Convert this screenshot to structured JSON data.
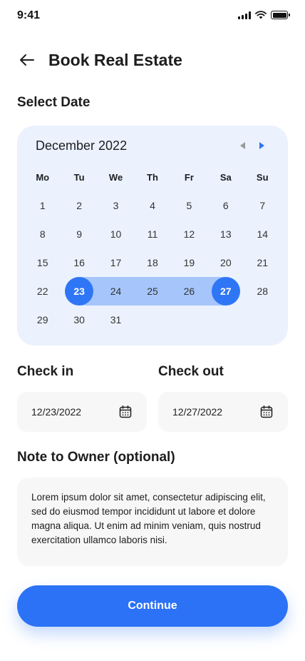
{
  "status_bar": {
    "time": "9:41"
  },
  "header": {
    "title": "Book Real Estate"
  },
  "select_date": {
    "label": "Select Date"
  },
  "calendar": {
    "month_label": "December 2022",
    "accent": "#2f76f6",
    "range_color": "#a6c6fb",
    "weekdays": [
      "Mo",
      "Tu",
      "We",
      "Th",
      "Fr",
      "Sa",
      "Su"
    ],
    "weeks": [
      [
        "1",
        "2",
        "3",
        "4",
        "5",
        "6",
        "7"
      ],
      [
        "8",
        "9",
        "10",
        "11",
        "12",
        "13",
        "14"
      ],
      [
        "15",
        "16",
        "17",
        "18",
        "19",
        "20",
        "21"
      ],
      [
        "22",
        "23",
        "24",
        "25",
        "26",
        "27",
        "28"
      ],
      [
        "29",
        "30",
        "31",
        "",
        "",
        "",
        ""
      ]
    ],
    "range_start": "23",
    "range_end": "27"
  },
  "check_in": {
    "label": "Check in",
    "value": "12/23/2022"
  },
  "check_out": {
    "label": "Check out",
    "value": "12/27/2022"
  },
  "note": {
    "label": "Note to Owner (optional)",
    "value": "Lorem ipsum dolor sit amet, consectetur adipiscing elit, sed do eiusmod tempor incididunt ut labore et dolore magna aliqua. Ut enim ad minim veniam, quis nostrud exercitation ullamco laboris nisi."
  },
  "continue_button": {
    "label": "Continue"
  }
}
